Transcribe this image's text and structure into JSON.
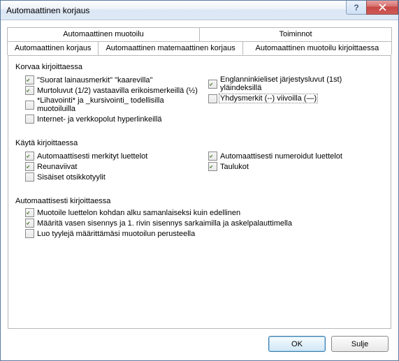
{
  "window": {
    "title": "Automaattinen korjaus"
  },
  "tabs_row1": [
    {
      "label": "Automaattinen muotoilu"
    },
    {
      "label": "Toiminnot"
    }
  ],
  "tabs_row2": [
    {
      "label": "Automaattinen korjaus"
    },
    {
      "label": "Automaattinen matemaattinen korjaus"
    },
    {
      "label": "Automaattinen muotoilu kirjoittaessa"
    }
  ],
  "sections": {
    "replace": {
      "heading": "Korvaa kirjoittaessa",
      "quotes": "\"Suorat lainausmerkit\" \"kaarevilla\"",
      "ordinals": "Englanninkieliset järjestysluvut (1st) yläindeksillä",
      "fractions": "Murtoluvut (1/2) vastaavilla erikoismerkeillä (½)",
      "hyphens": "Yhdysmerkit (--) viivoilla (—)",
      "boldital": "*Lihavointi* ja _kursivointi_ todellisilla muotoiluilla",
      "hyperlinks": "Internet- ja verkkopolut hyperlinkeillä"
    },
    "apply": {
      "heading": "Käytä kirjoittaessa",
      "bulleted": "Automaattisesti merkityt luettelot",
      "numbered": "Automaattisesti numeroidut luettelot",
      "borders": "Reunaviivat",
      "tables": "Taulukot",
      "headings": "Sisäiset otsikkotyylit"
    },
    "auto": {
      "heading": "Automaattisesti kirjoittaessa",
      "listformat": "Muotoile luettelon kohdan alku samanlaiseksi kuin edellinen",
      "indent": "Määritä vasen sisennys ja 1. rivin sisennys sarkaimilla ja askelpalauttimella",
      "styles": "Luo tyylejä määrittämäsi muotoilun perusteella"
    }
  },
  "buttons": {
    "ok": "OK",
    "close": "Sulje"
  }
}
